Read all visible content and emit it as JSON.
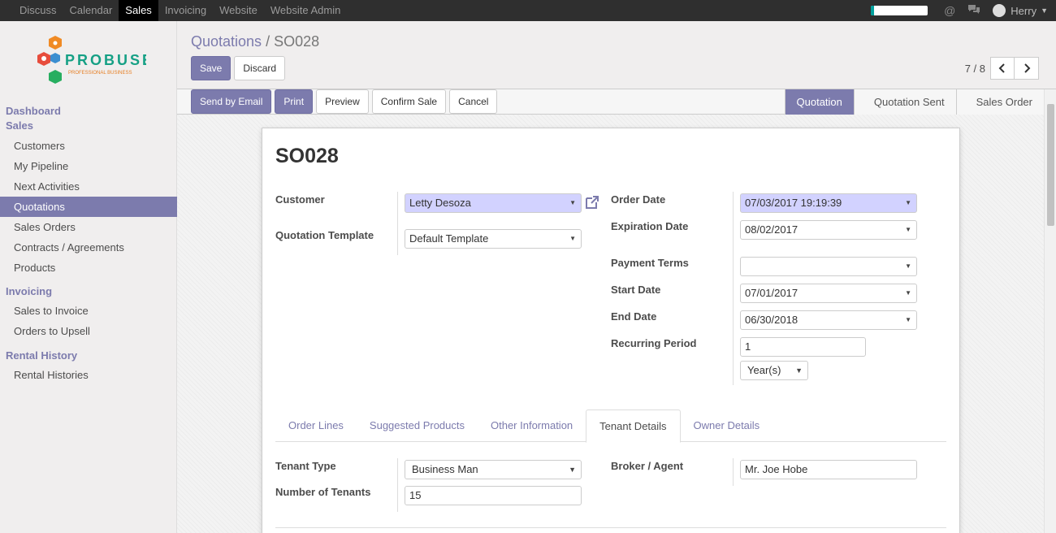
{
  "topbar": {
    "menu": [
      "Discuss",
      "Calendar",
      "Sales",
      "Invoicing",
      "Website",
      "Website Admin"
    ],
    "active_index": 2,
    "progress_fraction": 0.05,
    "user": "Herry"
  },
  "sidebar": {
    "logo": {
      "name": "PROBUSE",
      "tagline": "PROFESSIONAL BUSINESS"
    },
    "sections": [
      {
        "title": "Dashboard",
        "items": []
      },
      {
        "title": "Sales",
        "items": [
          "Customers",
          "My Pipeline",
          "Next Activities",
          "Quotations",
          "Sales Orders",
          "Contracts / Agreements",
          "Products"
        ]
      },
      {
        "title": "Invoicing",
        "items": [
          "Sales to Invoice",
          "Orders to Upsell"
        ]
      },
      {
        "title": "Rental History",
        "items": [
          "Rental Histories"
        ]
      }
    ],
    "active_item": "Quotations"
  },
  "control_panel": {
    "breadcrumb_parent": "Quotations",
    "breadcrumb_sep": "/",
    "breadcrumb_current": "SO028",
    "save_label": "Save",
    "discard_label": "Discard",
    "pager_value": "7 / 8"
  },
  "statusbar": {
    "buttons": [
      "Send by Email",
      "Print",
      "Preview",
      "Confirm Sale",
      "Cancel"
    ],
    "stages": [
      "Quotation",
      "Quotation Sent",
      "Sales Order"
    ],
    "active_stage": "Quotation"
  },
  "form": {
    "title": "SO028",
    "customer_label": "Customer",
    "customer_value": "Letty Desoza",
    "template_label": "Quotation Template",
    "template_value": "Default Template",
    "order_date_label": "Order Date",
    "order_date_value": "07/03/2017 19:19:39",
    "expiration_label": "Expiration Date",
    "expiration_value": "08/02/2017",
    "payment_terms_label": "Payment Terms",
    "payment_terms_value": "",
    "start_date_label": "Start Date",
    "start_date_value": "07/01/2017",
    "end_date_label": "End Date",
    "end_date_value": "06/30/2018",
    "recurring_label": "Recurring Period",
    "recurring_value": "1",
    "recurring_unit": "Year(s)",
    "tabs": [
      "Order Lines",
      "Suggested Products",
      "Other Information",
      "Tenant Details",
      "Owner Details"
    ],
    "active_tab": "Tenant Details",
    "tenant_type_label": "Tenant Type",
    "tenant_type_value": "Business Man",
    "num_tenants_label": "Number of Tenants",
    "num_tenants_value": "15",
    "broker_label": "Broker / Agent",
    "broker_value": "Mr. Joe Hobe"
  }
}
